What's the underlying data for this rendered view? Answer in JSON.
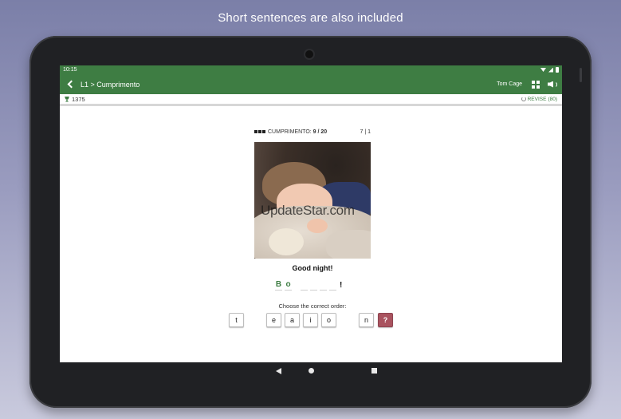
{
  "caption": "Short sentences are also included",
  "status_bar": {
    "time": "10:15"
  },
  "app_bar": {
    "breadcrumb": "L1 > Cumprimento",
    "user_name": "Tom Cage",
    "icons": {
      "back": "back-arrow-icon",
      "view": "grid-icon",
      "sound": "speaker-icon"
    }
  },
  "subbar": {
    "score": "1375",
    "revise_label": "REVISE",
    "revise_count": "(80)",
    "icons": {
      "score": "trophy-icon",
      "revise": "refresh-icon"
    }
  },
  "exercise": {
    "progress_label": "CUMPRIMENTO:",
    "progress_value": "9 / 20",
    "counter": "7 | 1",
    "image_watermark": "UpdateStar.com",
    "prompt": "Good night!",
    "answer_letters": [
      "B",
      "o"
    ],
    "answer_punctuation": "!",
    "instruction": "Choose the correct order:",
    "tiles": [
      "t",
      "e",
      "a",
      "i",
      "o",
      "n"
    ],
    "hint_label": "?"
  },
  "colors": {
    "primary": "#3e7d43",
    "hint": "#a9535f",
    "background": "#8c8fb6"
  },
  "nav_bar": {
    "icons": [
      "back-triangle-icon",
      "home-circle-icon",
      "recents-square-icon"
    ]
  }
}
